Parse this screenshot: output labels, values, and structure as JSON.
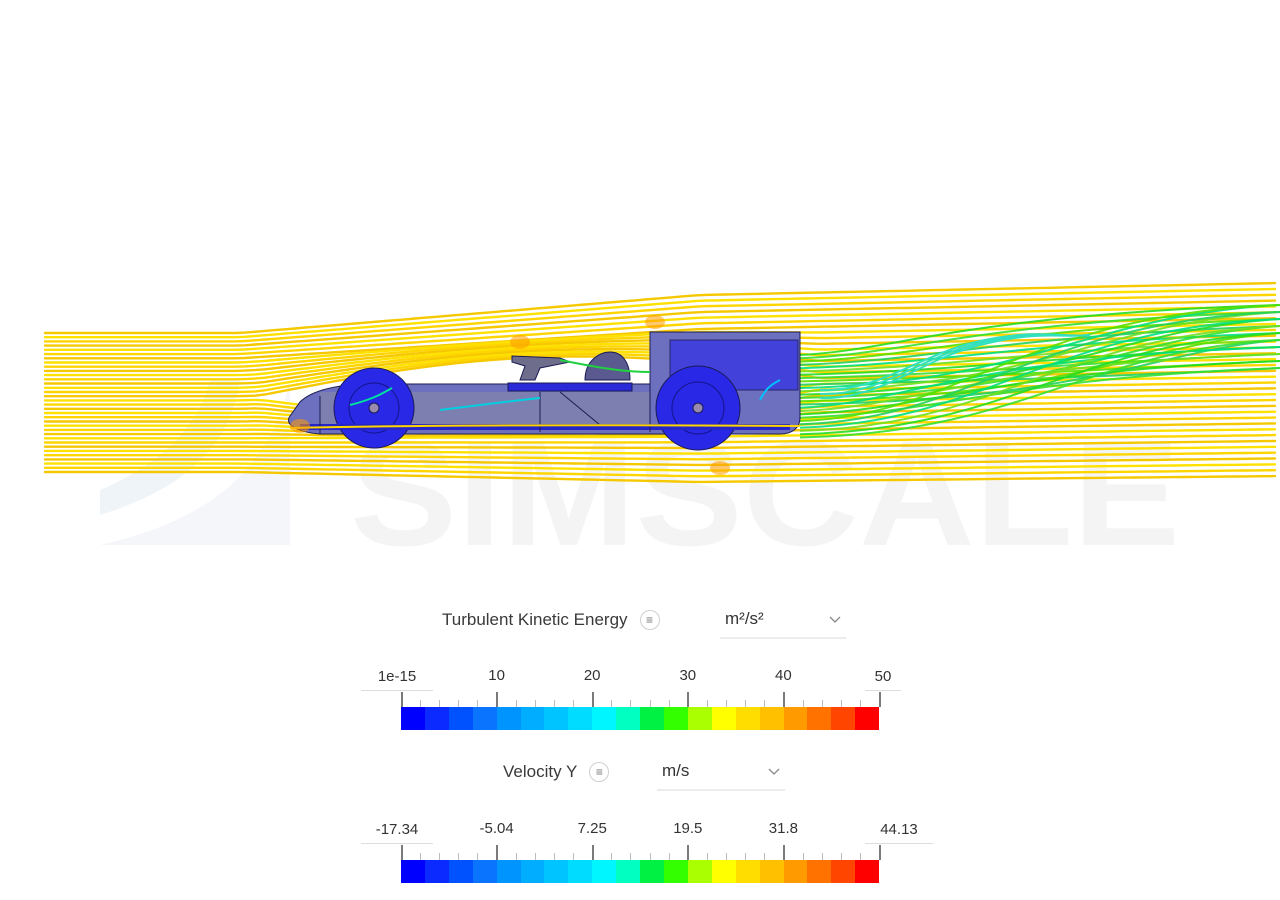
{
  "viewport": {
    "description": "CFD streamline visualization of race car",
    "watermark_text": "SIMSCALE",
    "streamline_base_color": "#ffe000"
  },
  "legends": [
    {
      "quantity": "Turbulent Kinetic Energy",
      "menu_icon": "menu-icon",
      "unit": "m²/s²",
      "min_label": "1e-15",
      "max_label": "50",
      "tick_labels": [
        "10",
        "20",
        "30",
        "40"
      ],
      "min": 1e-15,
      "max": 50
    },
    {
      "quantity": "Velocity Y",
      "menu_icon": "menu-icon",
      "unit": "m/s",
      "min_label": "-17.34",
      "max_label": "44.13",
      "tick_labels": [
        "-5.04",
        "7.25",
        "19.5",
        "31.8"
      ],
      "min": -17.34,
      "max": 44.13
    }
  ],
  "colormap": [
    "#0000ff",
    "#0a2aff",
    "#0052ff",
    "#0a74ff",
    "#0094ff",
    "#00adff",
    "#00c4ff",
    "#00dcff",
    "#00f6ff",
    "#00ffc0",
    "#00f044",
    "#33ff00",
    "#aaff00",
    "#ffff00",
    "#ffdd00",
    "#ffc000",
    "#ff9a00",
    "#ff7200",
    "#ff4500",
    "#ff0000"
  ]
}
